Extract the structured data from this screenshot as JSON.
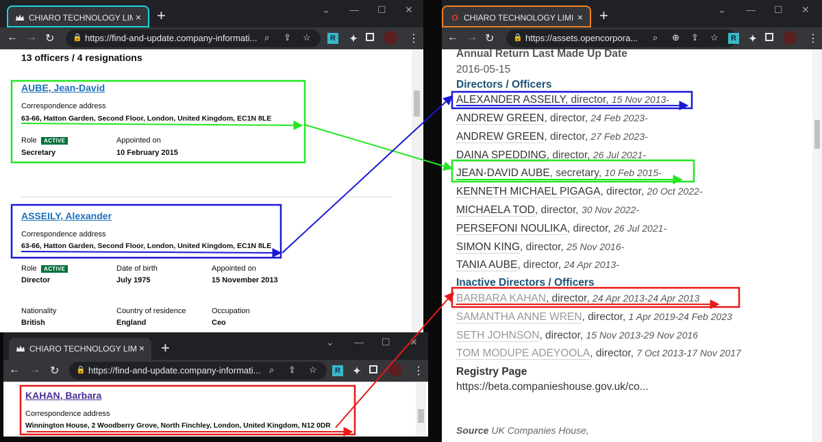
{
  "left_window": {
    "tab_title": "CHIARO TECHNOLOGY LIMITED",
    "url": "https://find-and-update.company-informati...",
    "officers_heading": "13 officers / 4 resignations",
    "officers": [
      {
        "name": "AUBE, Jean-David",
        "address_label": "Correspondence address",
        "address": "63-66, Hatton Garden, Second Floor, London, United Kingdom, EC1N 8LE",
        "role_label": "Role",
        "status": "ACTIVE",
        "role": "Secretary",
        "appointed_label": "Appointed on",
        "appointed": "10 February 2015"
      },
      {
        "name": "ASSEILY, Alexander",
        "address_label": "Correspondence address",
        "address": "63-66, Hatton Garden, Second Floor, London, United Kingdom, EC1N 8LE",
        "role_label": "Role",
        "status": "ACTIVE",
        "role": "Director",
        "dob_label": "Date of birth",
        "dob": "July 1975",
        "appointed_label": "Appointed on",
        "appointed": "15 November 2013",
        "nationality_label": "Nationality",
        "nationality": "British",
        "residence_label": "Country of residence",
        "residence": "England",
        "occupation_label": "Occupation",
        "occupation": "Ceo"
      }
    ]
  },
  "bottom_window": {
    "tab_title": "CHIARO TECHNOLOGY LIMITED",
    "url": "https://find-and-update.company-informati...",
    "officer": {
      "name": "KAHAN, Barbara",
      "address_label": "Correspondence address",
      "address": "Winnington House, 2 Woodberry Grove, North Finchley, London, United Kingdom, N12 0DR"
    }
  },
  "right_window": {
    "tab_title": "CHIARO TECHNOLOGY LIMITED",
    "url": "https://assets.opencorpora...",
    "annual_return_label": "Annual Return Last Made Up Date",
    "annual_return_date": "2016-05-15",
    "directors_heading": "Directors / Officers",
    "directors": [
      {
        "name": "ALEXANDER ASSEILY",
        "role": ", director, ",
        "dates": "15 Nov 2013-"
      },
      {
        "name": "ANDREW GREEN",
        "role": ", director, ",
        "dates": "24 Feb 2023-"
      },
      {
        "name": "ANDREW GREEN",
        "role": ", director, ",
        "dates": "27 Feb 2023-"
      },
      {
        "name": "DAINA SPEDDING",
        "role": ", director, ",
        "dates": "26 Jul 2021-"
      },
      {
        "name": "JEAN-DAVID AUBE",
        "role": ", secretary, ",
        "dates": "10 Feb 2015-"
      },
      {
        "name": "KENNETH MICHAEL PIGAGA",
        "role": ", director, ",
        "dates": "20 Oct 2022-"
      },
      {
        "name": "MICHAELA TOD",
        "role": ", director, ",
        "dates": "30 Nov 2022-"
      },
      {
        "name": "PERSEFONI NOULIKA",
        "role": ", director, ",
        "dates": "26 Jul 2021-"
      },
      {
        "name": "SIMON KING",
        "role": ", director, ",
        "dates": "25 Nov 2016-"
      },
      {
        "name": "TANIA AUBE",
        "role": ", director, ",
        "dates": "24 Apr 2013-"
      }
    ],
    "inactive_heading": "Inactive Directors / Officers",
    "inactive": [
      {
        "name": "BARBARA KAHAN",
        "role": ", director, ",
        "dates": "24 Apr 2013-24 Apr 2013"
      },
      {
        "name": "SAMANTHA ANNE WREN",
        "role": ", director, ",
        "dates": "1 Apr 2019-24 Feb 2023"
      },
      {
        "name": "SETH JOHNSON",
        "role": ", director, ",
        "dates": "15 Nov 2013-29 Nov 2016"
      },
      {
        "name": "TOM MODUPE ADEYOOLA",
        "role": ", director, ",
        "dates": "7 Oct 2013-17 Nov 2017"
      }
    ],
    "registry_label": "Registry Page",
    "registry_url": "https://beta.companieshouse.gov.uk/co...",
    "source_label": "Source",
    "source_value": "UK Companies House,"
  },
  "annotation_colors": {
    "green": "#22e622",
    "blue": "#1818d6",
    "red": "#e81818",
    "cyan_tab": "#17d6e0",
    "orange_tab": "#f08020"
  },
  "icons": {
    "gov_tab": "crown-icon",
    "oc_tab": "opencorporates-icon",
    "ext_pr": "pr-extension-icon",
    "ext_puzzle": "puzzle-icon",
    "side_panel": "side-panel-icon",
    "avatar": "avatar"
  }
}
